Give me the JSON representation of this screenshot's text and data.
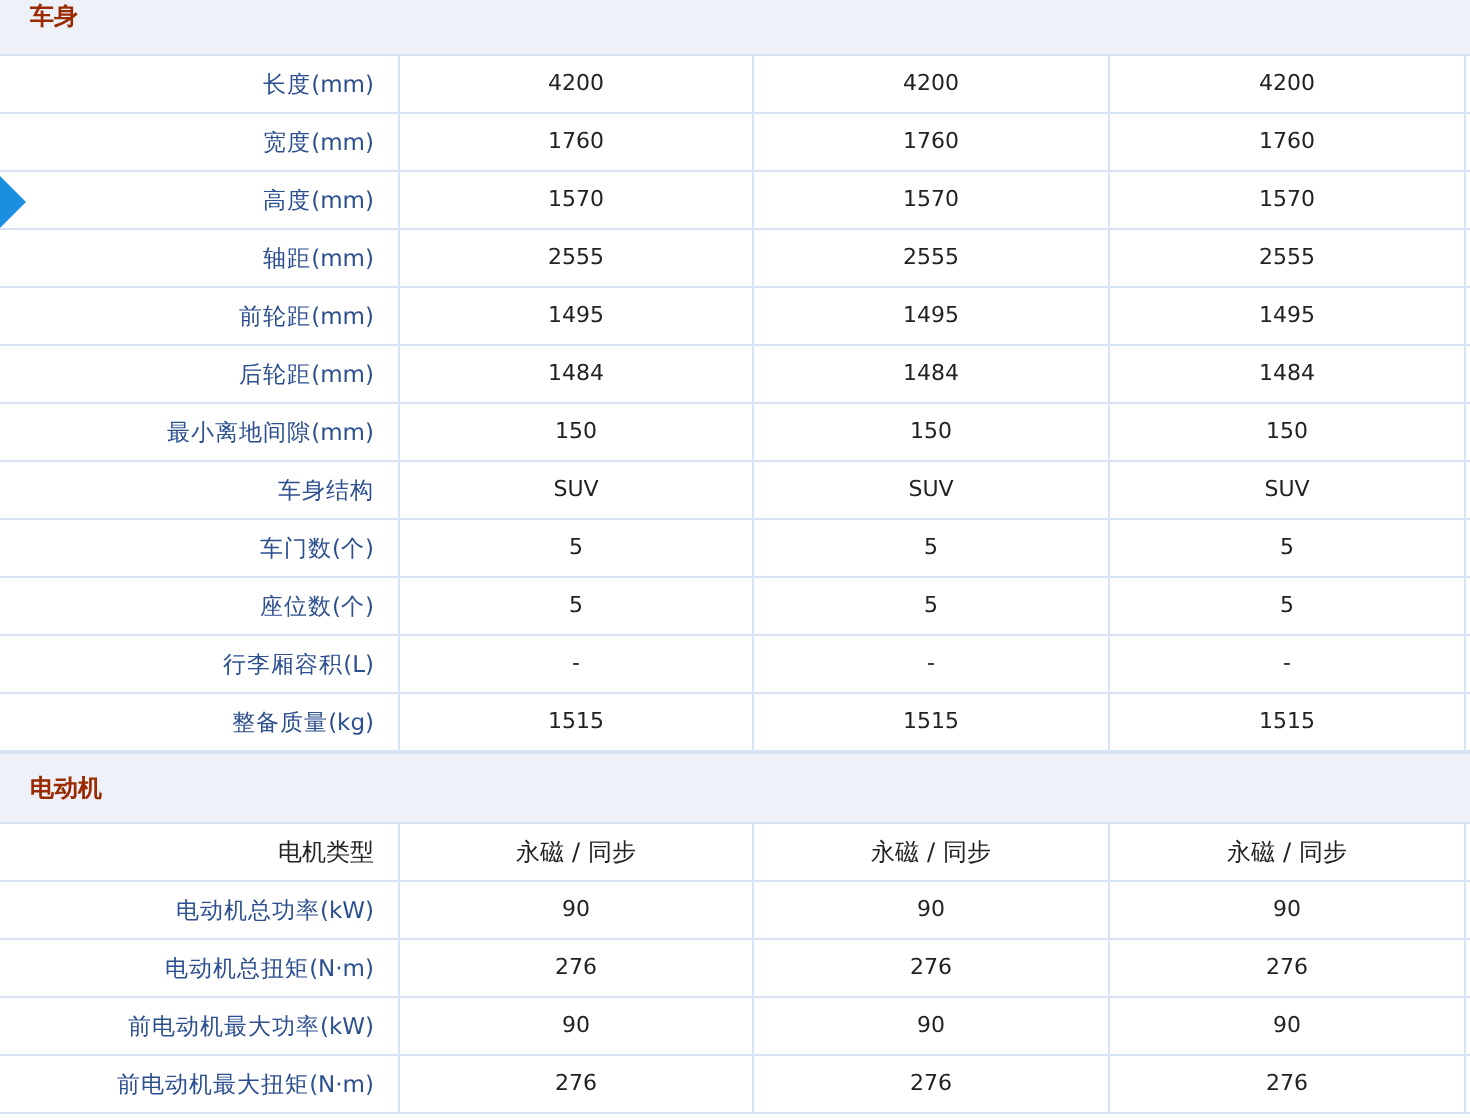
{
  "sections": [
    {
      "title": "车身",
      "rows": [
        {
          "kind": "spec",
          "label": "长度(mm)",
          "values": [
            "4200",
            "4200",
            "4200"
          ]
        },
        {
          "kind": "spec",
          "label": "宽度(mm)",
          "values": [
            "1760",
            "1760",
            "1760"
          ]
        },
        {
          "kind": "spec",
          "label": "高度(mm)",
          "values": [
            "1570",
            "1570",
            "1570"
          ]
        },
        {
          "kind": "spec",
          "label": "轴距(mm)",
          "values": [
            "2555",
            "2555",
            "2555"
          ]
        },
        {
          "kind": "spec",
          "label": "前轮距(mm)",
          "values": [
            "1495",
            "1495",
            "1495"
          ]
        },
        {
          "kind": "spec",
          "label": "后轮距(mm)",
          "values": [
            "1484",
            "1484",
            "1484"
          ]
        },
        {
          "kind": "spec",
          "label": "最小离地间隙(mm)",
          "values": [
            "150",
            "150",
            "150"
          ]
        },
        {
          "kind": "spec",
          "label": "车身结构",
          "values": [
            "SUV",
            "SUV",
            "SUV"
          ]
        },
        {
          "kind": "spec",
          "label": "车门数(个)",
          "values": [
            "5",
            "5",
            "5"
          ]
        },
        {
          "kind": "spec",
          "label": "座位数(个)",
          "values": [
            "5",
            "5",
            "5"
          ]
        },
        {
          "kind": "spec",
          "label": "行李厢容积(L)",
          "values": [
            "-",
            "-",
            "-"
          ]
        },
        {
          "kind": "spec",
          "label": "整备质量(kg)",
          "values": [
            "1515",
            "1515",
            "1515"
          ]
        }
      ]
    },
    {
      "title": "电动机",
      "rows": [
        {
          "kind": "plain",
          "label": "电机类型",
          "values": [
            "永磁 / 同步",
            "永磁 / 同步",
            "永磁 / 同步"
          ]
        },
        {
          "kind": "spec",
          "label": "电动机总功率(kW)",
          "values": [
            "90",
            "90",
            "90"
          ]
        },
        {
          "kind": "spec",
          "label": "电动机总扭矩(N·m)",
          "values": [
            "276",
            "276",
            "276"
          ]
        },
        {
          "kind": "spec",
          "label": "前电动机最大功率(kW)",
          "values": [
            "90",
            "90",
            "90"
          ]
        },
        {
          "kind": "spec",
          "label": "前电动机最大扭矩(N·m)",
          "values": [
            "276",
            "276",
            "276"
          ]
        }
      ]
    }
  ]
}
